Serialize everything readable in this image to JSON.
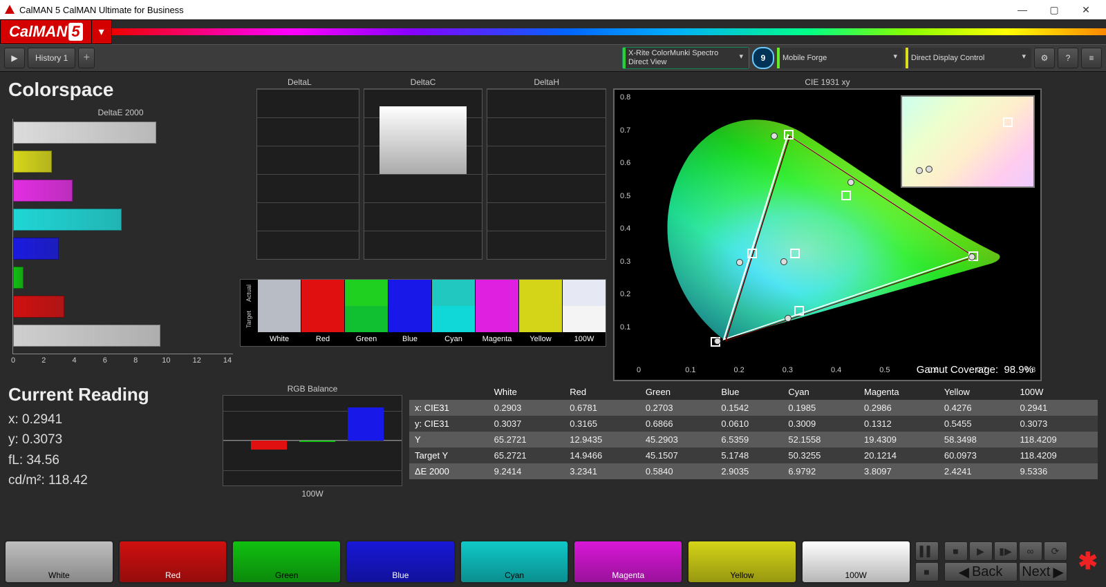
{
  "window_title": "CalMAN 5 CalMAN Ultimate for Business",
  "brand": {
    "name": "CalMAN",
    "ver": "5"
  },
  "tabs": {
    "history": "History 1"
  },
  "sources": {
    "meter": {
      "line1": "X-Rite ColorMunki Spectro",
      "line2": "Direct View"
    },
    "meter_count": "9",
    "gen": "Mobile Forge",
    "disp": "Direct Display Control"
  },
  "page_title": "Colorspace",
  "chart_data": {
    "deltaE2000": {
      "type": "bar",
      "orientation": "horizontal",
      "title": "DeltaE 2000",
      "xlim": [
        0,
        14
      ],
      "xticks": [
        0,
        2,
        4,
        6,
        8,
        10,
        12,
        14
      ],
      "categories": [
        "White",
        "Yellow",
        "Magenta",
        "Cyan",
        "Blue",
        "Green",
        "Red",
        "100W"
      ],
      "values": [
        9.24,
        2.42,
        3.81,
        6.98,
        2.9,
        0.58,
        3.23,
        9.53
      ],
      "bar_colors": [
        "#dcdcdc",
        "#d6d61a",
        "#e22ee2",
        "#20d6d6",
        "#1a1ae0",
        "#10c010",
        "#d01010",
        "#cfcfcf"
      ]
    },
    "deltaL": {
      "type": "bar",
      "title": "DeltaL",
      "ylim": [
        -15,
        15
      ],
      "yticks": [
        -15,
        -10,
        -5,
        0,
        5,
        10,
        15
      ],
      "categories": [
        "100W"
      ],
      "values": [
        0
      ]
    },
    "deltaC": {
      "type": "bar",
      "title": "DeltaC",
      "ylim": [
        -15,
        15
      ],
      "yticks": [
        -15,
        -10,
        -5,
        0,
        5,
        10,
        15
      ],
      "categories": [
        "100W"
      ],
      "values": [
        12
      ],
      "bar_colors": [
        "#f2f2f2"
      ]
    },
    "deltaH": {
      "type": "bar",
      "title": "DeltaH",
      "ylim": [
        -15,
        15
      ],
      "yticks": [
        -15,
        -10,
        -5,
        0,
        5,
        10,
        15
      ],
      "categories": [
        "100W"
      ],
      "values": [
        0
      ]
    },
    "swatches": {
      "labels": [
        "White",
        "Red",
        "Green",
        "Blue",
        "Cyan",
        "Magenta",
        "Yellow",
        "100W"
      ],
      "rows": [
        "Actual",
        "Target"
      ],
      "actual": [
        "#b8bcc4",
        "#e01010",
        "#20d020",
        "#1818e8",
        "#20c8c0",
        "#e020e0",
        "#d4d418",
        "#e6e8f4"
      ],
      "target": [
        "#b8bcc4",
        "#e01010",
        "#10c030",
        "#1818e8",
        "#10d8d8",
        "#e020e0",
        "#d4d418",
        "#f4f4f4"
      ]
    },
    "rgb_balance": {
      "type": "bar",
      "title": "RGB Balance",
      "ylim": [
        -30,
        30
      ],
      "yticks": [
        -20,
        0,
        20
      ],
      "categories": [
        "100W"
      ],
      "series": [
        {
          "name": "R",
          "value": -6,
          "color": "#e01010"
        },
        {
          "name": "G",
          "value": 0,
          "color": "#10c010"
        },
        {
          "name": "B",
          "value": 22,
          "color": "#1818e8"
        }
      ],
      "xlabel": "100W"
    },
    "cie": {
      "type": "scatter",
      "title": "CIE 1931 xy",
      "xlim": [
        0,
        0.8
      ],
      "ylim": [
        0,
        0.8
      ],
      "xticks": [
        0,
        0.1,
        0.2,
        0.3,
        0.4,
        0.5,
        0.6,
        0.7,
        0.8
      ],
      "yticks": [
        0.1,
        0.2,
        0.3,
        0.4,
        0.5,
        0.6,
        0.7,
        0.8
      ],
      "gamut_coverage_label": "Gamut Coverage:",
      "gamut_coverage": "98.9%",
      "target_points": [
        {
          "x": 0.3,
          "y": 0.69
        },
        {
          "x": 0.15,
          "y": 0.06
        },
        {
          "x": 0.68,
          "y": 0.32
        },
        {
          "x": 0.225,
          "y": 0.329
        },
        {
          "x": 0.321,
          "y": 0.154
        },
        {
          "x": 0.419,
          "y": 0.505
        },
        {
          "x": 0.3127,
          "y": 0.329
        }
      ],
      "measured_points": [
        {
          "x": 0.27,
          "y": 0.687
        },
        {
          "x": 0.154,
          "y": 0.061
        },
        {
          "x": 0.678,
          "y": 0.317
        },
        {
          "x": 0.199,
          "y": 0.301
        },
        {
          "x": 0.299,
          "y": 0.131
        },
        {
          "x": 0.428,
          "y": 0.546
        },
        {
          "x": 0.29,
          "y": 0.304
        }
      ]
    }
  },
  "current_reading": {
    "title": "Current Reading",
    "x": "x: 0.2941",
    "y": "y: 0.3073",
    "fL": "fL: 34.56",
    "cdm2": "cd/m²: 118.42"
  },
  "data_table": {
    "columns": [
      "",
      "White",
      "Red",
      "Green",
      "Blue",
      "Cyan",
      "Magenta",
      "Yellow",
      "100W"
    ],
    "rows": [
      {
        "label": "x: CIE31",
        "vals": [
          "0.2903",
          "0.6781",
          "0.2703",
          "0.1542",
          "0.1985",
          "0.2986",
          "0.4276",
          "0.2941"
        ]
      },
      {
        "label": "y: CIE31",
        "vals": [
          "0.3037",
          "0.3165",
          "0.6866",
          "0.0610",
          "0.3009",
          "0.1312",
          "0.5455",
          "0.3073"
        ]
      },
      {
        "label": "Y",
        "vals": [
          "65.2721",
          "12.9435",
          "45.2903",
          "6.5359",
          "52.1558",
          "19.4309",
          "58.3498",
          "118.4209"
        ]
      },
      {
        "label": "Target Y",
        "vals": [
          "65.2721",
          "14.9466",
          "45.1507",
          "5.1748",
          "50.3255",
          "20.1214",
          "60.0973",
          "118.4209"
        ]
      },
      {
        "label": "ΔE 2000",
        "vals": [
          "9.2414",
          "3.2341",
          "0.5840",
          "2.9035",
          "6.9792",
          "3.8097",
          "2.4241",
          "9.5336"
        ]
      }
    ]
  },
  "color_buttons": [
    {
      "label": "White",
      "bg": "#bfbfbf",
      "dark": false
    },
    {
      "label": "Red",
      "bg": "#d01010",
      "dark": true
    },
    {
      "label": "Green",
      "bg": "#10c010",
      "dark": false
    },
    {
      "label": "Blue",
      "bg": "#1818d8",
      "dark": true
    },
    {
      "label": "Cyan",
      "bg": "#10c8c8",
      "dark": false
    },
    {
      "label": "Magenta",
      "bg": "#d818d8",
      "dark": true
    },
    {
      "label": "Yellow",
      "bg": "#d4d418",
      "dark": false
    },
    {
      "label": "100W",
      "bg": "#ffffff",
      "dark": false
    }
  ],
  "nav": {
    "back": "Back",
    "next": "Next"
  }
}
